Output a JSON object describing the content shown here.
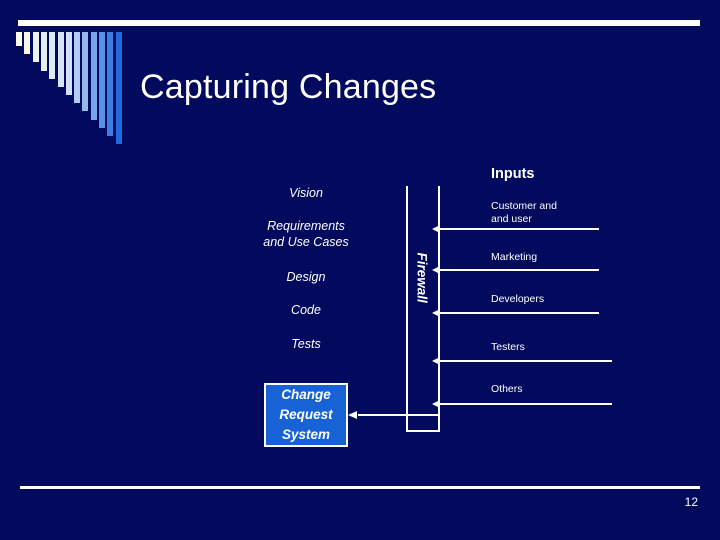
{
  "slide": {
    "background_color": "#010a5c",
    "title": "Capturing Changes",
    "page_number": "12"
  },
  "decor": {
    "accent_cream": "#fbfbe6",
    "accent_pale_blue": "#cfe0f7",
    "accent_blue": "#1f6ae0",
    "bar_count": 13
  },
  "diagram": {
    "stages": [
      {
        "label": "Vision"
      },
      {
        "label": "Requirements\nand Use Cases"
      },
      {
        "label": "Design"
      },
      {
        "label": "Code"
      },
      {
        "label": "Tests"
      }
    ],
    "change_request_box": {
      "label": "Change\nRequest\nSystem",
      "fill_color": "#1763d6",
      "border_color": "#ffffff"
    },
    "firewall": {
      "label": "Firewall"
    },
    "inputs": {
      "heading": "Inputs",
      "items": [
        {
          "label": "Customer and\nand user"
        },
        {
          "label": "Marketing"
        },
        {
          "label": "Developers"
        },
        {
          "label": "Testers"
        },
        {
          "label": "Others"
        }
      ]
    }
  }
}
